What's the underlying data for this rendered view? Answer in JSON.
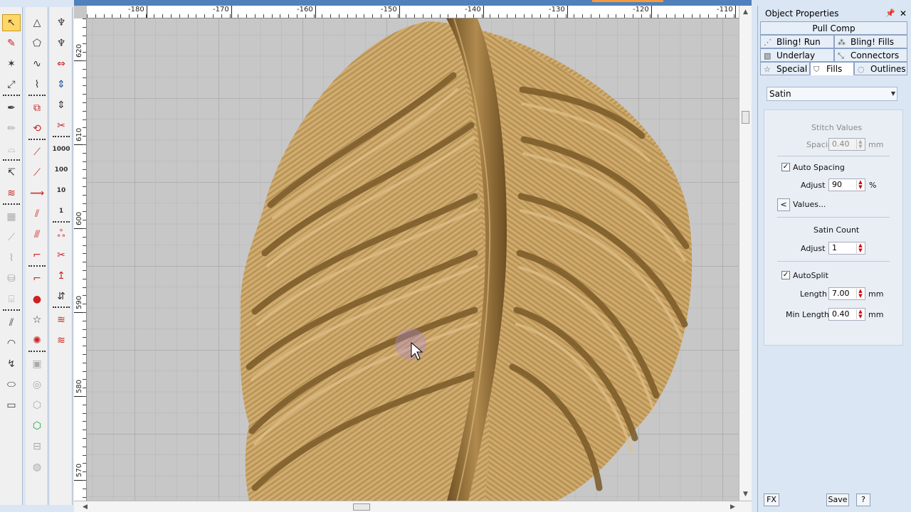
{
  "toolbars": {
    "col1": [
      {
        "name": "select-tool",
        "glyph": "↖",
        "active": true
      },
      {
        "name": "reshape-tool",
        "glyph": "✎",
        "style": "red"
      },
      {
        "name": "star-select-tool",
        "glyph": "✶"
      },
      {
        "name": "point-select-tool",
        "glyph": "⤢"
      },
      {
        "name": "pen-tool",
        "glyph": "✒"
      },
      {
        "name": "pencil-disabled-tool",
        "glyph": "✏",
        "style": "gray"
      },
      {
        "name": "stamp-disabled-tool",
        "glyph": "⌓",
        "style": "gray"
      },
      {
        "name": "stitch-select-tool",
        "glyph": "↸"
      },
      {
        "name": "stitch-edit-tool",
        "glyph": "≋",
        "style": "red"
      },
      {
        "name": "align-disabled-tool",
        "glyph": "▦",
        "style": "gray"
      },
      {
        "name": "knife-disabled-tool",
        "glyph": "⟋",
        "style": "gray"
      },
      {
        "name": "brush-disabled-tool",
        "glyph": "⌇",
        "style": "gray"
      },
      {
        "name": "bucket-disabled-tool",
        "glyph": "⛁",
        "style": "gray"
      },
      {
        "name": "camera-disabled-tool",
        "glyph": "⌺",
        "style": "gray"
      },
      {
        "name": "parallel-lines-tool",
        "glyph": "⫽"
      },
      {
        "name": "arc-tool",
        "glyph": "◠"
      },
      {
        "name": "bezier-tool",
        "glyph": "↯"
      },
      {
        "name": "ellipse-tool",
        "glyph": "⬭"
      },
      {
        "name": "rectangle-tool",
        "glyph": "▭"
      }
    ],
    "col2": [
      {
        "name": "triangle-tool",
        "glyph": "△"
      },
      {
        "name": "polygon-tool",
        "glyph": "⬠"
      },
      {
        "name": "curve-tool",
        "glyph": "∿"
      },
      {
        "name": "freehand-tool",
        "glyph": "⌇"
      },
      {
        "name": "crop-tool",
        "glyph": "⧉",
        "style": "red"
      },
      {
        "name": "rotate-tool",
        "glyph": "⟲",
        "style": "red"
      },
      {
        "name": "line-1-tool",
        "glyph": "⟋",
        "style": "red"
      },
      {
        "name": "line-3-tool",
        "glyph": "⟋",
        "style": "red"
      },
      {
        "name": "zigzag-tool",
        "glyph": "⟿",
        "style": "red"
      },
      {
        "name": "hatch-tool",
        "glyph": "⫽",
        "style": "red"
      },
      {
        "name": "cross-hatch-tool",
        "glyph": "⫻",
        "style": "red"
      },
      {
        "name": "polyline-tool",
        "glyph": "⌐",
        "style": "red"
      },
      {
        "name": "polyline-3-tool",
        "glyph": "⌐",
        "style": "red"
      },
      {
        "name": "circle-fill-tool",
        "glyph": "●",
        "style": "red"
      },
      {
        "name": "star-tool",
        "glyph": "☆"
      },
      {
        "name": "rosette-tool",
        "glyph": "✺",
        "style": "red"
      },
      {
        "name": "frame-disabled-tool",
        "glyph": "▣",
        "style": "gray"
      },
      {
        "name": "circles-disabled-tool",
        "glyph": "◎",
        "style": "gray"
      },
      {
        "name": "hexagon-disabled-tool",
        "glyph": "⬡",
        "style": "gray"
      },
      {
        "name": "hexagon-green-tool",
        "glyph": "⬡",
        "style": "green"
      },
      {
        "name": "slider-disabled-tool",
        "glyph": "⊟",
        "style": "gray"
      },
      {
        "name": "round-disabled-tool",
        "glyph": "◍",
        "style": "gray"
      }
    ],
    "col3": [
      {
        "name": "machine-stitch-tool",
        "glyph": "♆"
      },
      {
        "name": "machine-stitch-2-tool",
        "glyph": "♆"
      },
      {
        "name": "stitch-width-tool",
        "glyph": "⇔",
        "style": "red"
      },
      {
        "name": "stitch-color-tool",
        "glyph": "⇕",
        "style": "blue"
      },
      {
        "name": "stitch-arrows-tool",
        "glyph": "⇕"
      },
      {
        "name": "scissors-tool",
        "glyph": "✂",
        "style": "red"
      },
      {
        "name": "step-1000-tool",
        "glyph": "1000",
        "style": "num"
      },
      {
        "name": "step-100-tool",
        "glyph": "100",
        "style": "num"
      },
      {
        "name": "step-10-tool",
        "glyph": "10",
        "style": "num"
      },
      {
        "name": "step-1-tool",
        "glyph": "1",
        "style": "num"
      },
      {
        "name": "tie-stitch-tool",
        "glyph": "ஃ",
        "style": "red"
      },
      {
        "name": "trim-tool",
        "glyph": "✂",
        "style": "red"
      },
      {
        "name": "jump-tool",
        "glyph": "↥",
        "style": "red"
      },
      {
        "name": "jump-arrows-tool",
        "glyph": "⇵"
      },
      {
        "name": "run-stitch-tool",
        "glyph": "≋",
        "style": "red"
      },
      {
        "name": "run-stitch-2-tool",
        "glyph": "≋",
        "style": "red"
      }
    ]
  },
  "ruler": {
    "top_labels": [
      "-180",
      "-170",
      "-160",
      "-150",
      "-140",
      "-130",
      "-120",
      "-110"
    ],
    "left_labels": [
      "620",
      "610",
      "600",
      "590",
      "580",
      "570"
    ]
  },
  "panel": {
    "title": "Object Properties",
    "pin": "░",
    "close": "✕",
    "tabs": {
      "pull_comp": "Pull Comp",
      "bling_run": "Bling! Run",
      "bling_fills": "Bling! Fills",
      "underlay": "Underlay",
      "connectors": "Connectors",
      "special": "Special",
      "fills": "Fills",
      "outlines": "Outlines"
    },
    "fill_type": "Satin",
    "stitch_values_heading": "Stitch Values",
    "spacing_label": "Spacing",
    "spacing_value": "0.40",
    "spacing_unit": "mm",
    "auto_spacing_label": "Auto Spacing",
    "auto_spacing_checked": "✓",
    "adjust_label": "Adjust",
    "adjust_value": "90",
    "adjust_unit": "%",
    "values_button_arrow": "<",
    "values_label": "Values...",
    "satin_count_heading": "Satin Count",
    "satin_adjust_label": "Adjust",
    "satin_adjust_value": "1",
    "autosplit_label": "AutoSplit",
    "autosplit_checked": "✓",
    "length_label": "Length",
    "length_value": "7.00",
    "length_unit": "mm",
    "min_length_label": "Min Length",
    "min_length_value": "0.40",
    "min_length_unit": "mm",
    "fx_button": "FX",
    "save_button": "Save",
    "help_button": "?"
  },
  "colors": {
    "embroidery_base": "#c9a468",
    "embroidery_dark": "#7a5a28",
    "embroidery_light": "#e2c28c",
    "grid": "#9a9a9a",
    "canvas_bg": "#c7c7c7"
  }
}
